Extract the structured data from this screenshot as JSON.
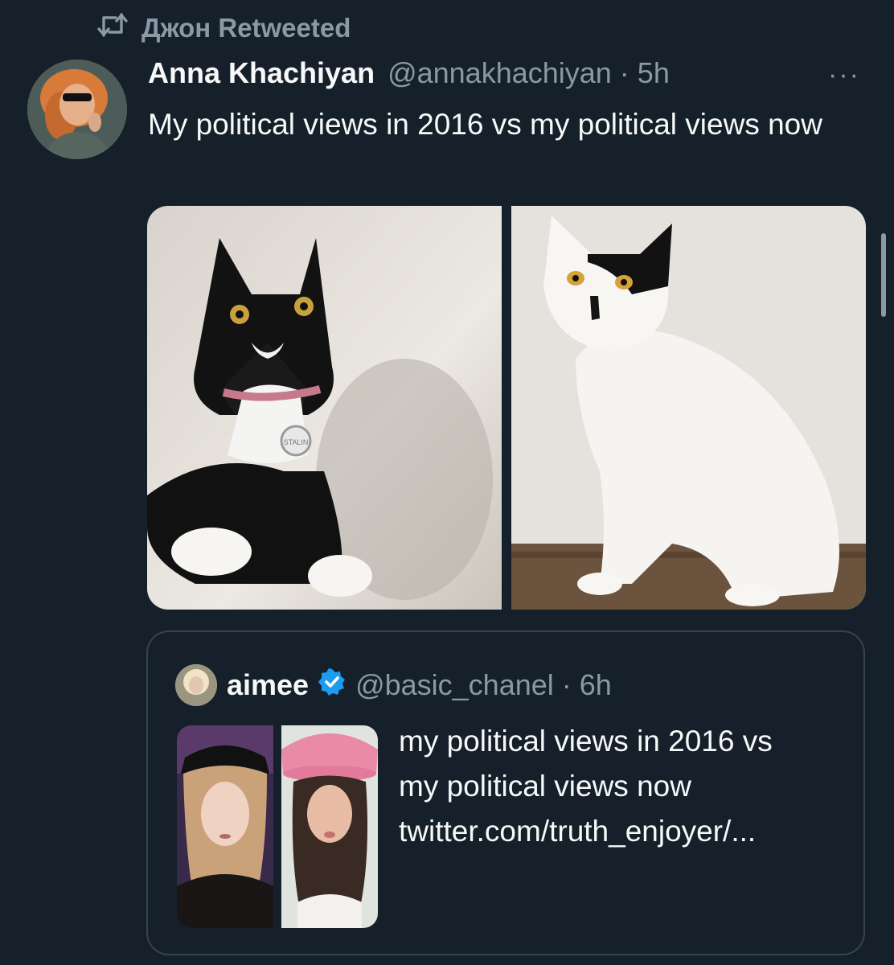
{
  "retweet": {
    "icon": "retweet-icon",
    "text": "Джон Retweeted"
  },
  "tweet": {
    "author_name": "Anna Khachiyan",
    "handle_time": "@annakhachiyan · 5h",
    "more_icon": "ellipsis-icon",
    "more_label": "···",
    "text": "My political views in 2016 vs my political views now",
    "media": [
      {
        "description": "black and white tuxedo cat with pink collar and tag",
        "tag_text": "STALIN"
      },
      {
        "description": "white cat with black patch over eye and black mustache spot"
      }
    ]
  },
  "quote": {
    "author_name": "aimee",
    "verified_icon": "verified-badge-icon",
    "handle_time": "@basic_chanel · 6h",
    "text_lines": [
      "my political views in 2016 vs",
      "my political views now",
      "twitter.com/truth_enjoyer/..."
    ],
    "media": [
      {
        "description": "woman with black flower crown"
      },
      {
        "description": "woman wearing pink cowboy hat"
      }
    ]
  },
  "colors": {
    "background": "#15202b",
    "primary_text": "#f7f9f9",
    "secondary_text": "#8b98a5",
    "border": "#38444d",
    "verified_blue": "#1d9bf0"
  }
}
